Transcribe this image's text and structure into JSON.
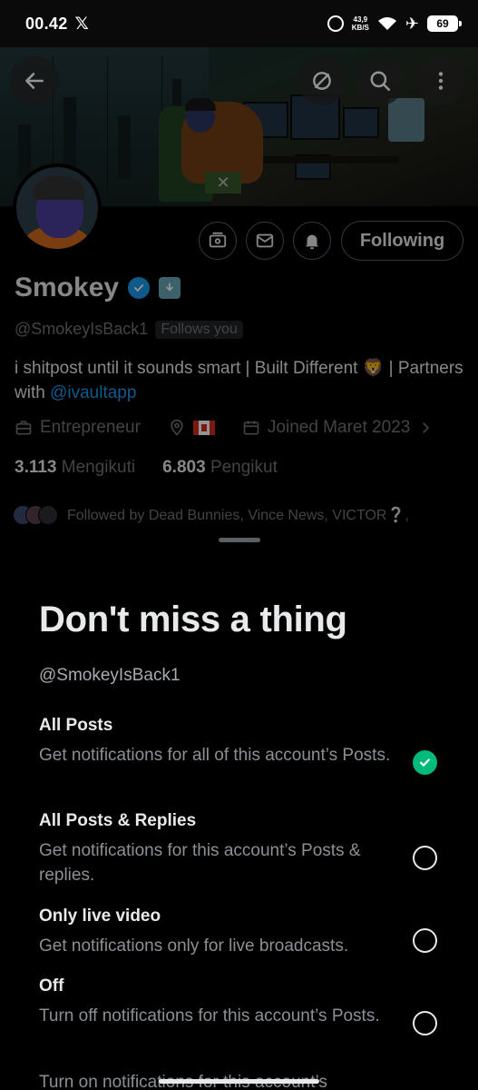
{
  "status": {
    "time": "00.42",
    "network_speed_value": "43,9",
    "network_speed_unit": "KB/S",
    "battery": "69"
  },
  "header": {
    "following_label": "Following"
  },
  "profile": {
    "name": "Smokey",
    "handle": "@SmokeyIsBack1",
    "follows_you": "Follows you",
    "bio_text": "i shitpost until it sounds smart  | Built Different 🦁 | Partners with ",
    "bio_link": "@ivaultapp",
    "category": "Entrepreneur",
    "flag": "🇨🇦",
    "joined": "Joined Maret 2023",
    "following_count": "3.113",
    "following_label": "Mengikuti",
    "followers_count": "6.803",
    "followers_label": "Pengikut",
    "followed_by": "Followed by Dead Bunnies, Vince News, VICTOR❔,"
  },
  "sheet": {
    "title": "Don't miss a thing",
    "handle": "@SmokeyIsBack1",
    "options": [
      {
        "title": "All Posts",
        "desc": "Get notifications for all of this account’s Posts.",
        "selected": true
      },
      {
        "title": "All Posts & Replies",
        "desc": "Get notifications for this account’s Posts & replies.",
        "selected": false
      },
      {
        "title": "Only live video",
        "desc": "Get notifications only for live broadcasts.",
        "selected": false
      },
      {
        "title": "Off",
        "desc": "Turn off notifications for this account’s Posts.",
        "selected": false
      }
    ],
    "cut_off_text": "Turn on notifications for this account’s"
  },
  "colors": {
    "accent": "#1d9bf0",
    "check_green": "#00ba7c",
    "muted": "#71767b"
  },
  "icons": [
    "back-arrow-icon",
    "grok-icon",
    "search-icon",
    "more-vertical-icon",
    "subscribe-icon",
    "message-icon",
    "notification-bell-icon",
    "briefcase-icon",
    "location-icon",
    "calendar-icon",
    "chevron-right-icon",
    "check-icon"
  ]
}
